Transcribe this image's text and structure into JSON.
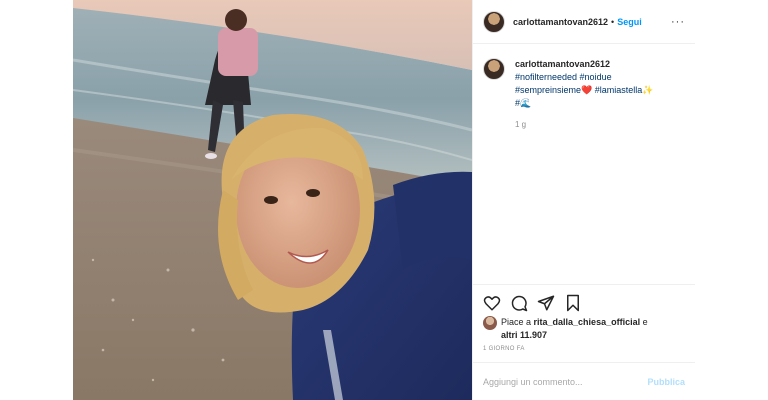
{
  "post": {
    "username": "carlottamantovan2612",
    "separator": "•",
    "follow_label": "Segui",
    "more_label": "···"
  },
  "caption": {
    "username": "carlottamantovan2612",
    "line1": "#nofilterneeded #noidue",
    "line2": "#sempreinsieme❤️ #lamiastella✨",
    "line3": "#🌊",
    "time": "1 g"
  },
  "actions": {
    "icons": [
      "heart-icon",
      "comment-icon",
      "share-icon",
      "bookmark-icon"
    ]
  },
  "likes": {
    "prefix": "Piace a ",
    "user": "rita_dalla_chiesa_official",
    "middle": " e",
    "others": "altri 11.907"
  },
  "date": "1 GIORNO FA",
  "comment": {
    "placeholder": "Aggiungi un commento...",
    "publish_label": "Pubblica"
  },
  "colors": {
    "link": "#0095f6",
    "publish_disabled": "#b2dffc",
    "muted": "#8e8e8e"
  }
}
